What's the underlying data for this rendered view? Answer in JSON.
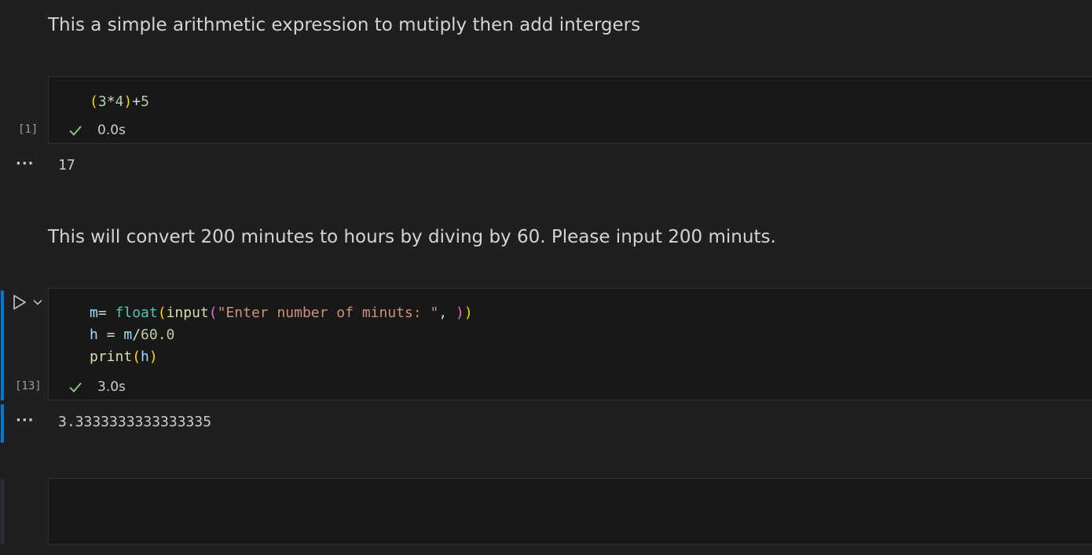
{
  "cells": [
    {
      "type": "markdown",
      "text": "This a simple arithmetic expression to mutiply then add intergers"
    },
    {
      "type": "code",
      "exec_count": "[1]",
      "exec_time": "0.0s",
      "status": "success",
      "code_tokens": [
        [
          [
            "(",
            "tk-p1"
          ],
          [
            "3",
            "tk-num"
          ],
          [
            "*",
            "tk-op"
          ],
          [
            "4",
            "tk-num"
          ],
          [
            ")",
            "tk-p1"
          ],
          [
            "+",
            "tk-op"
          ],
          [
            "5",
            "tk-num"
          ]
        ]
      ],
      "output_menu": "···",
      "output": "17"
    },
    {
      "type": "markdown",
      "text": "This will convert 200 minutes to hours by diving by 60. Please input 200 minuts."
    },
    {
      "type": "code",
      "exec_count": "[13]",
      "exec_time": "3.0s",
      "status": "success",
      "focused": true,
      "code_tokens": [
        [
          [
            "m",
            "tk-var"
          ],
          [
            "= ",
            "tk-op"
          ],
          [
            "float",
            "tk-type"
          ],
          [
            "(",
            "tk-p1"
          ],
          [
            "input",
            "tk-func"
          ],
          [
            "(",
            "tk-p2"
          ],
          [
            "\"Enter number of minuts: \"",
            "tk-str"
          ],
          [
            ", ",
            "tk-op"
          ],
          [
            ")",
            "tk-p2"
          ],
          [
            ")",
            "tk-p1"
          ]
        ],
        [
          [
            "h",
            "tk-var"
          ],
          [
            " = ",
            "tk-op"
          ],
          [
            "m",
            "tk-var"
          ],
          [
            "/",
            "tk-op"
          ],
          [
            "60.0",
            "tk-num"
          ]
        ],
        [
          [
            "print",
            "tk-func"
          ],
          [
            "(",
            "tk-p1"
          ],
          [
            "h",
            "tk-var"
          ],
          [
            ")",
            "tk-p1"
          ]
        ]
      ],
      "output_menu": "···",
      "output": "3.3333333333333335"
    },
    {
      "type": "code",
      "empty": true
    }
  ],
  "icons": {
    "run": "run-cell-icon",
    "run_menu": "chevron-down-icon",
    "status": "check-icon"
  },
  "colors": {
    "background": "#1f1f1f",
    "cell_background": "#181818",
    "focus_accent": "#0078d4",
    "success": "#89d185"
  }
}
